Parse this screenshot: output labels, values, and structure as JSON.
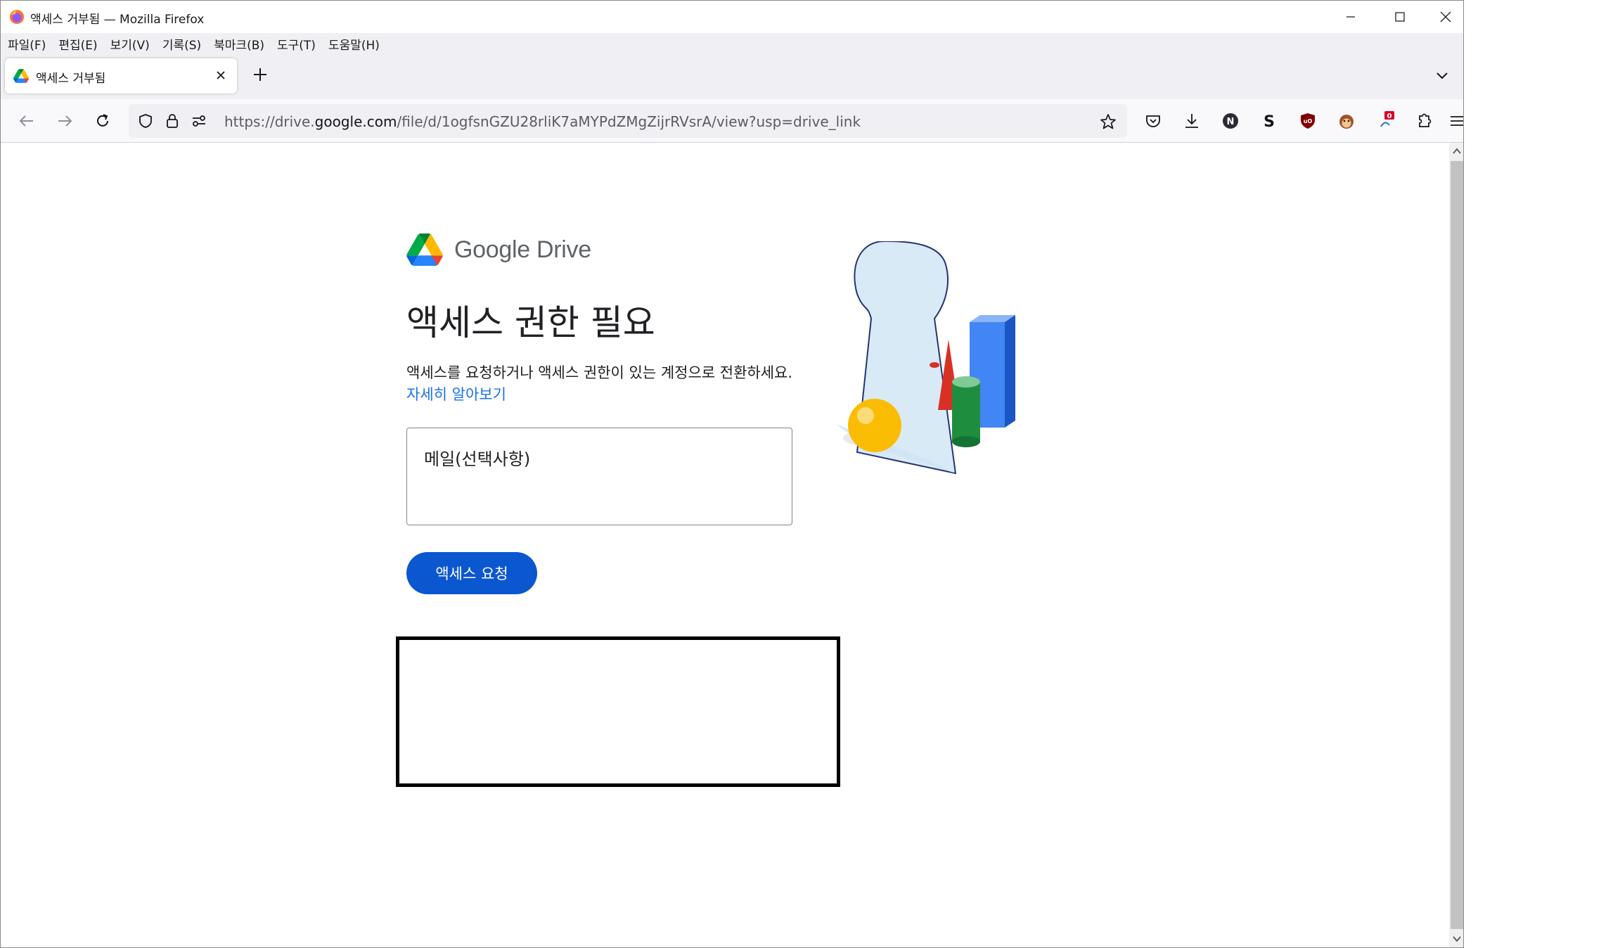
{
  "window": {
    "title": "액세스 거부됨 — Mozilla Firefox"
  },
  "menubar": {
    "items": [
      "파일(F)",
      "편집(E)",
      "보기(V)",
      "기록(S)",
      "북마크(B)",
      "도구(T)",
      "도움말(H)"
    ]
  },
  "tab": {
    "title": "액세스 거부됨"
  },
  "urlbar": {
    "prefix": "https://drive.",
    "host": "google.com",
    "path": "/file/d/1ogfsnGZU28rliK7aMYPdZMgZijrRVsrA/view?usp=drive_link"
  },
  "toolbar": {
    "extension_badge": "0",
    "icons": [
      "pocket-icon",
      "download-icon",
      "n-extension-icon",
      "s-extension-icon",
      "ublock-icon",
      "monkey-extension-icon",
      "badge-extension-icon",
      "extensions-icon",
      "hamburger-menu-icon"
    ]
  },
  "page": {
    "logo_text": "Google Drive",
    "heading": "액세스 권한 필요",
    "description": "액세스를 요청하거나 액세스 권한이 있는 계정으로 전환하세요.",
    "learn_more": "자세히 알아보기",
    "email_placeholder": "메일(선택사항)",
    "request_button": "액세스 요청"
  },
  "colors": {
    "primary_button": "#0b57d0",
    "link": "#1a73e8",
    "heading": "#202124"
  }
}
